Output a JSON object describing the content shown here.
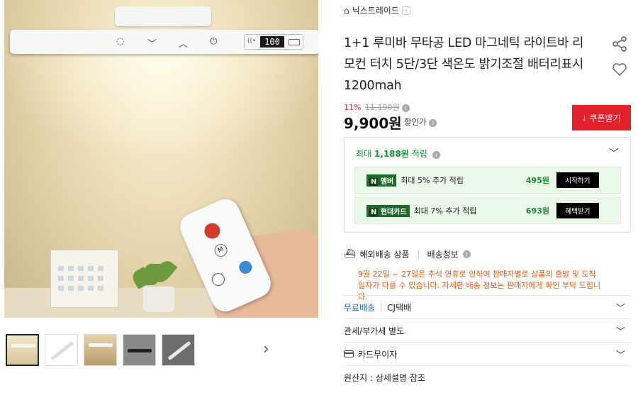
{
  "product_image": {
    "display_readout": "100",
    "remote_button": "M"
  },
  "gallery": {
    "thumb_count": 5,
    "active_index": 0
  },
  "seller": {
    "name": "닉스트레이드"
  },
  "product": {
    "title": "1+1 루미바 무타공 LED 마그네틱 라이트바 리모컨 터치 5단/3단 색온도 밝기조절 배터리표시 1200mah"
  },
  "pricing": {
    "discount_pct": "11%",
    "original_price": "11,190원",
    "price": "9,900원",
    "price_note": "할인가",
    "coupon_label": "쿠폰받기"
  },
  "rewards": {
    "prefix": "최대",
    "amount": "1,188원",
    "suffix": "적립",
    "offers": [
      {
        "badge_mark": "N",
        "badge": "멤버",
        "text": "최대 5% 추가 적립",
        "amount": "495원",
        "button": "시작하기"
      },
      {
        "badge_mark": "N",
        "badge": "현대카드",
        "text": "최대 7% 추가 적립",
        "amount": "693원",
        "button": "혜택받기"
      }
    ]
  },
  "shipping": {
    "overseas_label": "해외배송 상품",
    "info_label": "배송정보",
    "notice": "9월 22일 ~ 27일은 추석 연휴로 인하여 판매자별로 상품의 출발 및 도착 일자가 다를 수 있습니다. 자세한 배송 정보는 판매자에게 확인 부탁 드립니다."
  },
  "rows": {
    "free_shipping": "무료배송",
    "carrier": "CJ택배",
    "customs": "관세/부가세 별도",
    "card_installment": "카드무이자",
    "origin": "원산지 : 상세설명 참조"
  },
  "colors": {
    "accent_red": "#e4222d",
    "reward_green": "#16913a",
    "notice_orange": "#e05b16",
    "link_blue": "#1b66c9"
  }
}
